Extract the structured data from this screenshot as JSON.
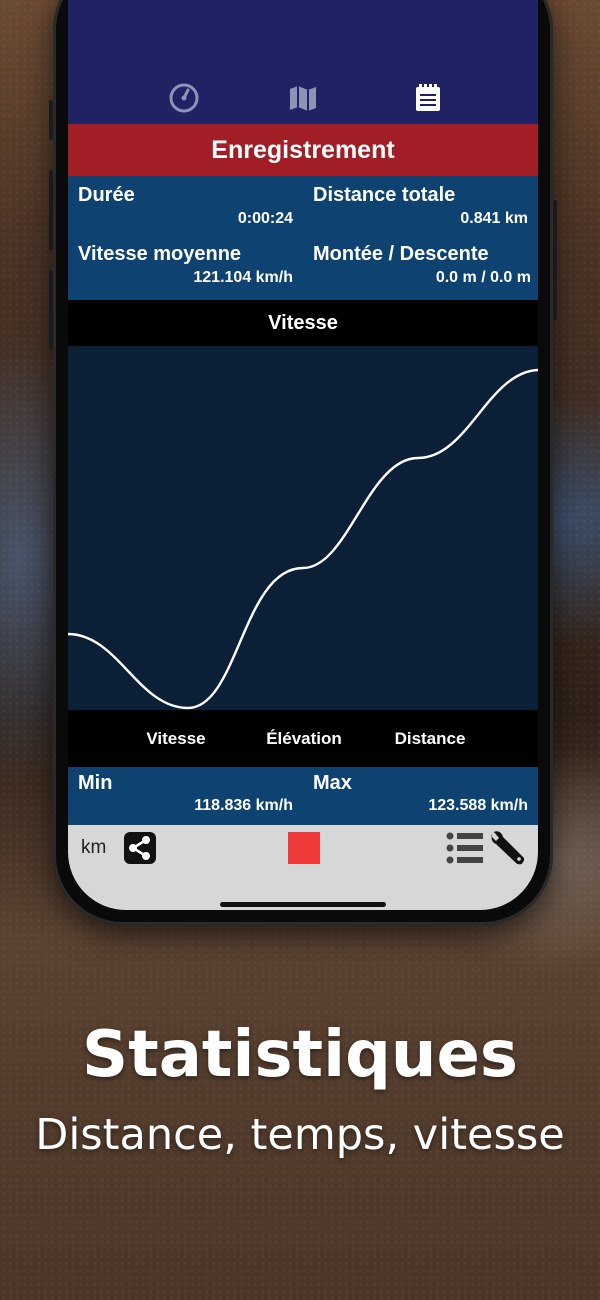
{
  "app": {
    "tabs": [
      {
        "icon": "speedometer-icon"
      },
      {
        "icon": "map-icon"
      },
      {
        "icon": "notepad-icon",
        "active": true
      }
    ],
    "header_title": "Enregistrement",
    "stats": {
      "duration_label": "Durée",
      "duration_value": "0:00:24",
      "total_distance_label": "Distance totale",
      "total_distance_value": "0.841 km",
      "avg_speed_label": "Vitesse moyenne",
      "avg_speed_value": "121.104 km/h",
      "climb_label": "Montée / Descente",
      "climb_value": "0.0 m / 0.0 m"
    },
    "chart_title": "Vitesse",
    "segments": [
      "Vitesse",
      "Élévation",
      "Distance"
    ],
    "minmax": {
      "min_label": "Min",
      "min_value": "118.836 km/h",
      "max_label": "Max",
      "max_value": "123.588 km/h"
    },
    "bottom": {
      "unit_label": "km",
      "share_icon": "share-icon",
      "stop_icon": "stop-icon",
      "list_icon": "list-icon",
      "settings_icon": "wrench-icon",
      "stop_color": "#f03a3a"
    }
  },
  "caption": {
    "title": "Statistiques",
    "subtitle": "Distance, temps, vitesse"
  },
  "colors": {
    "navbar": "#202363",
    "header_red": "#a11e26",
    "stats_blue": "#0e4270",
    "chart_bg": "#0b2037"
  }
}
